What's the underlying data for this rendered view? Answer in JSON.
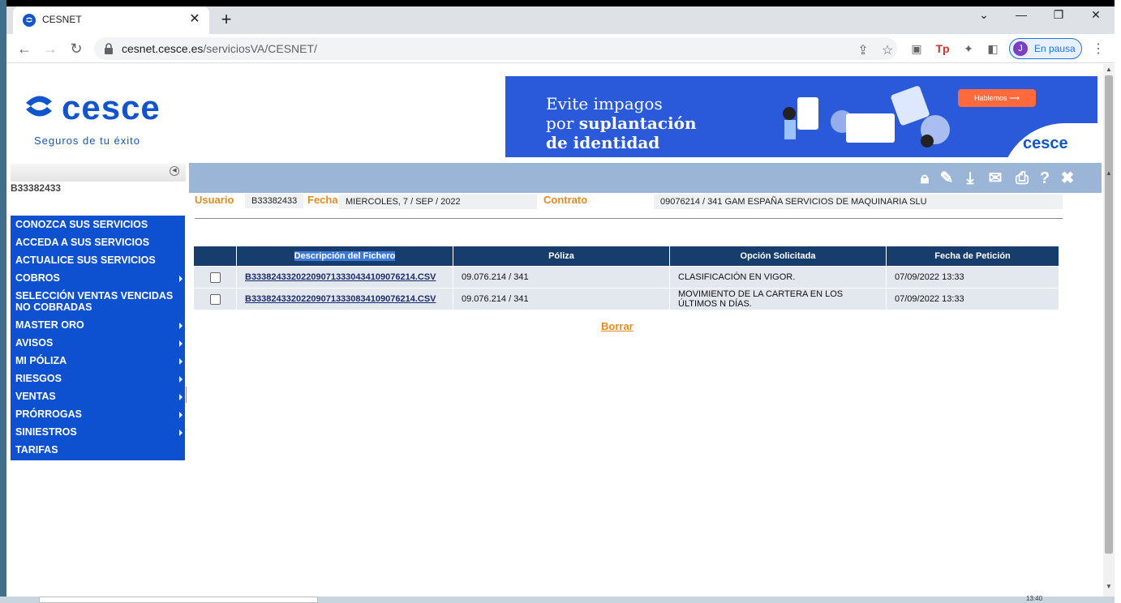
{
  "browser": {
    "tab_title": "CESNET",
    "close_glyph": "✕",
    "new_tab_glyph": "+",
    "url_host": "cesnet.cesce.es",
    "url_path": "/serviciosVA/CESNET/",
    "profile_initial": "J",
    "profile_label": "En pausa",
    "win_min": "—",
    "win_restore": "❐",
    "win_close": "✕"
  },
  "header": {
    "logo_word": "cesce",
    "logo_tagline": "Seguros de tu éxito",
    "banner": {
      "line1": "Evite impagos",
      "line2_regular": "por ",
      "line2_bold": "suplantación",
      "line3": "de identidad",
      "cta": "Hablemos ⟶",
      "brand": "cesce"
    }
  },
  "sidebar": {
    "user_id": "B33382433",
    "items": [
      {
        "label": "CONOZCA SUS SERVICIOS",
        "arrow": false
      },
      {
        "label": "ACCEDA A SUS SERVICIOS",
        "arrow": false
      },
      {
        "label": "ACTUALICE SUS SERVICIOS",
        "arrow": false
      },
      {
        "label": "COBROS",
        "arrow": true
      },
      {
        "label": "SELECCIÓN VENTAS VENCIDAS NO COBRADAS",
        "arrow": false
      },
      {
        "label": "MASTER ORO",
        "arrow": true
      },
      {
        "label": "AVISOS",
        "arrow": true
      },
      {
        "label": "MI PÓLIZA",
        "arrow": true
      },
      {
        "label": "RIESGOS",
        "arrow": true
      },
      {
        "label": "VENTAS",
        "arrow": true
      },
      {
        "label": "PRÓRROGAS",
        "arrow": true
      },
      {
        "label": "SINIESTROS",
        "arrow": true
      },
      {
        "label": "TARIFAS",
        "arrow": false
      }
    ]
  },
  "info": {
    "usuario_label": "Usuario",
    "usuario_value": "B33382433",
    "fecha_label": "Fecha",
    "fecha_value": "MIERCOLES, 7 / SEP / 2022",
    "contrato_label": "Contrato",
    "contrato_value": "09076214 / 341 GAM ESPAÑA SERVICIOS DE MAQUINARIA SLU"
  },
  "table": {
    "headers": [
      "Descripción del Fichero",
      "Póliza",
      "Opción Solicitada",
      "Fecha de Petición"
    ],
    "rows": [
      {
        "file": "B33382433202209071333043410907621​4.CSV",
        "poliza": "09.076.214 / 341",
        "opcion": "CLASIFICACIÓN EN VIGOR.",
        "fecha": "07/09/2022 13:33"
      },
      {
        "file": "B33382433202209071333083410907621​4.CSV",
        "poliza": "09.076.214 / 341",
        "opcion": "MOVIMIENTO DE LA CARTERA EN LOS ÚLTIMOS N DÍAS.",
        "fecha": "07/09/2022 13:33"
      }
    ]
  },
  "actions": {
    "borrar": "Borrar"
  },
  "icons": [
    "lock-icon",
    "edit-icon",
    "download-icon",
    "mail-icon",
    "print-icon",
    "help-icon",
    "close-icon"
  ],
  "colors": {
    "brand_blue": "#1155cc",
    "menu_blue": "#0d51d1",
    "orange": "#e58a1f",
    "header_band": "#9bb5d6",
    "table_head": "#173d6d"
  },
  "taskbar": {
    "clock": "13:40"
  }
}
